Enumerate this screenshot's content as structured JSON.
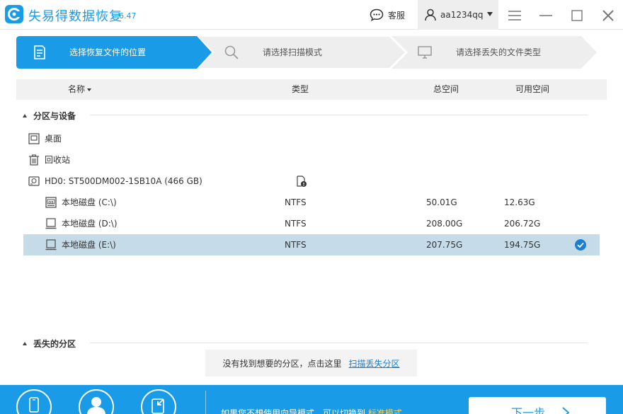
{
  "app": {
    "name": "失易得数据恢复",
    "version": "6.47"
  },
  "titlebar": {
    "support_label": "客服",
    "username": "aa1234qq"
  },
  "steps": [
    {
      "label": "选择恢复文件的位置",
      "active": true
    },
    {
      "label": "请选择扫描模式",
      "active": false
    },
    {
      "label": "请选择丢失的文件类型",
      "active": false
    }
  ],
  "table": {
    "headers": {
      "name": "名称",
      "type": "类型",
      "total": "总空间",
      "free": "可用空间"
    }
  },
  "sections": {
    "devices": "分区与设备",
    "lost": "丢失的分区"
  },
  "locations": {
    "desktop": "桌面",
    "recycle": "回收站",
    "disk": "HD0: ST500DM002-1SB10A (466 GB)"
  },
  "partitions": [
    {
      "name": "本地磁盘 (C:\\)",
      "fs": "NTFS",
      "total": "50.01G",
      "free": "12.63G",
      "icon": "os-drive-icon",
      "selected": false
    },
    {
      "name": "本地磁盘 (D:\\)",
      "fs": "NTFS",
      "total": "208.00G",
      "free": "206.72G",
      "icon": "drive-icon",
      "selected": false
    },
    {
      "name": "本地磁盘 (E:\\)",
      "fs": "NTFS",
      "total": "207.75G",
      "free": "194.75G",
      "icon": "drive-icon",
      "selected": true
    }
  ],
  "lost_prompt": {
    "text": "没有找到想要的分区，点击这里",
    "link": "扫描丢失分区"
  },
  "bottom": {
    "hint_text": "如果您不想使用向导模式，可以切换到",
    "hint_link": "标准模式",
    "next_label": "下一步"
  },
  "colors": {
    "accent": "#1a9be8",
    "selected_row": "#c5dbe8",
    "step_inactive": "#eeeeee"
  }
}
